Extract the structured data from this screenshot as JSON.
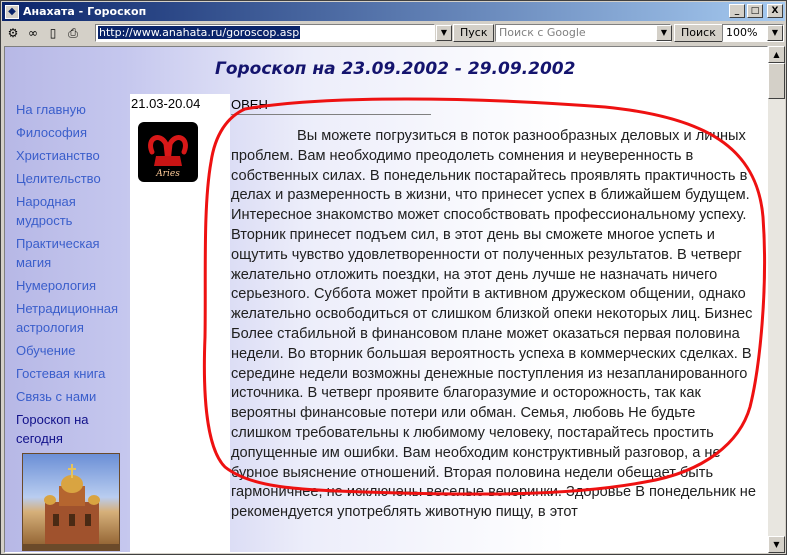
{
  "window": {
    "title": "Анахата - Гороскоп",
    "minimize": "_",
    "maximize": "□",
    "close": "X"
  },
  "toolbar": {
    "address": "http://www.anahata.ru/goroscop.asp",
    "go_label": "Пуск",
    "search_placeholder": "Поиск с Google",
    "search_label": "Поиск",
    "zoom": "100%"
  },
  "page": {
    "title": "Гороскоп на 23.09.2002 - 29.09.2002"
  },
  "nav": {
    "items": [
      {
        "label": "На главную"
      },
      {
        "label": "Философия"
      },
      {
        "label": "Христианство"
      },
      {
        "label": "Целительство"
      },
      {
        "label": "Народная мудрость"
      },
      {
        "label": "Практическая магия"
      },
      {
        "label": "Нумерология"
      },
      {
        "label": "Нетрадиционная астрология"
      },
      {
        "label": "Обучение"
      },
      {
        "label": "Гостевая книга"
      },
      {
        "label": "Связь с нами"
      },
      {
        "label": "Гороскоп на сегодня"
      }
    ]
  },
  "sign": {
    "dates": "21.03-20.04",
    "name": "ОВЕН",
    "symbol_label": "Aries",
    "text": "Вы можете погрузиться в поток разнообразных деловых и личных проблем. Вам необходимо преодолеть сомнения и неуверенность в собственных силах. В понедельник постарайтесь проявлять практичность в делах и размеренность в жизни, что принесет успех в ближайшем будущем. Интересное знакомство может способствовать профессиональному успеху. Вторник принесет подъем сил, в этот день вы сможете многое успеть и ощутить чувство удовлетворенности от полученных результатов. В четверг желательно отложить поездки, на этот день лучше не назначать ничего серьезного. Суббота может пройти в активном дружеском общении, однако желательно освободиться от слишком близкой опеки некоторых лиц. Бизнес Более стабильной в финансовом плане может оказаться первая половина недели. Во вторник большая вероятность успеха в коммерческих сделках. В середине недели возможны денежные поступления из незапланированного источника. В четверг проявите благоразумие и осторожность, так как вероятны финансовые потери или обман. Семья, любовь Не будьте слишком требовательны к любимому человеку, постарайтесь простить допущенные им ошибки. Вам необходим конструктивный разговор, а не бурное выяснение отношений. Вторая половина недели обещает быть гармоничнее, не исключены веселые вечеринки. Здоровье В понедельник не рекомендуется употреблять животную пищу, в этот"
  },
  "colors": {
    "accent": "#0a246a",
    "link": "#3a5ecb",
    "title": "#14146e",
    "annotation": "#ee1111"
  }
}
